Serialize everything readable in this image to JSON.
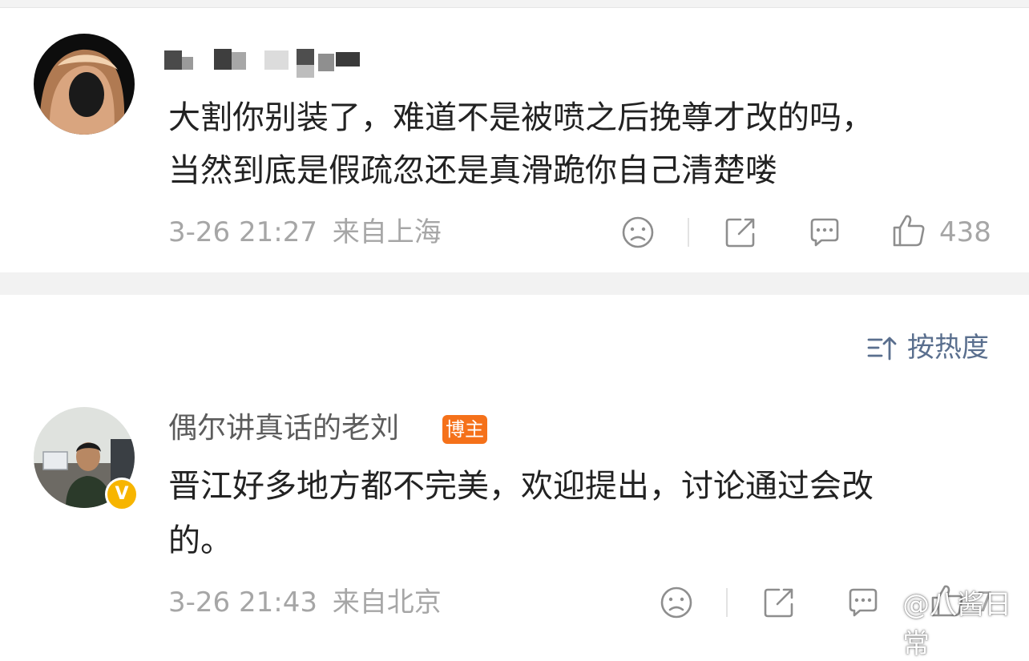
{
  "comments": [
    {
      "username": "",
      "text_line1": "大割你别装了，难道不是被喷之后挽尊才改的吗，",
      "text_line2": "当然到底是假疏忽还是真滑跪你自己清楚喽",
      "time": "3-26 21:27",
      "location": "来自上海",
      "likes": "438"
    },
    {
      "username": "偶尔讲真话的老刘",
      "badge": "博主",
      "verified_mark": "V",
      "text_line1": "晋江好多地方都不完美，欢迎提出，讨论通过会改",
      "text_line2": "的。",
      "time": "3-26 21:43",
      "location": "来自北京",
      "likes": "7"
    }
  ],
  "sort": {
    "label": "按热度"
  },
  "watermark": {
    "text": "@八酱日常"
  },
  "colors": {
    "badge": "#f5711a",
    "verified": "#f7b500",
    "sort_text": "#5a6f8e",
    "meta_text": "#a6a6a6",
    "body_text": "#222222"
  },
  "icons": {
    "dislike": "sad-face-icon",
    "share": "share-icon",
    "reply": "comment-bubble-icon",
    "like": "thumbs-up-icon",
    "sort": "sort-icon",
    "weibo": "weibo-logo-icon"
  }
}
